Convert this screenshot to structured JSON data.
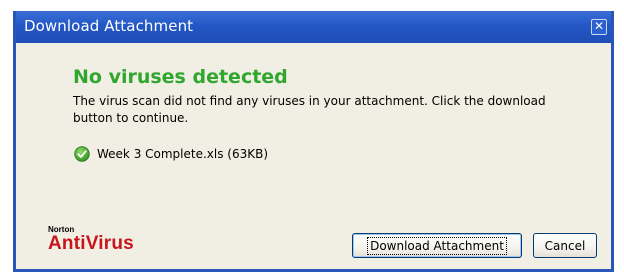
{
  "window": {
    "title": "Download Attachment",
    "close_symbol": "✕"
  },
  "content": {
    "heading": "No viruses detected",
    "message": "The virus scan did not find any viruses in your attachment. Click the download button to continue.",
    "file": {
      "name": "Week 3 Complete.xls (63KB)",
      "status_icon": "check-circle-icon"
    }
  },
  "logo": {
    "brand_small": "Norton",
    "brand_big": "AntiVirus"
  },
  "buttons": {
    "download_label": "Download Attachment",
    "cancel_label": "Cancel"
  },
  "colors": {
    "title_bar": "#2457c6",
    "heading_green": "#2fa62e",
    "logo_red": "#c8151b",
    "dialog_bg": "#f1efe4"
  }
}
